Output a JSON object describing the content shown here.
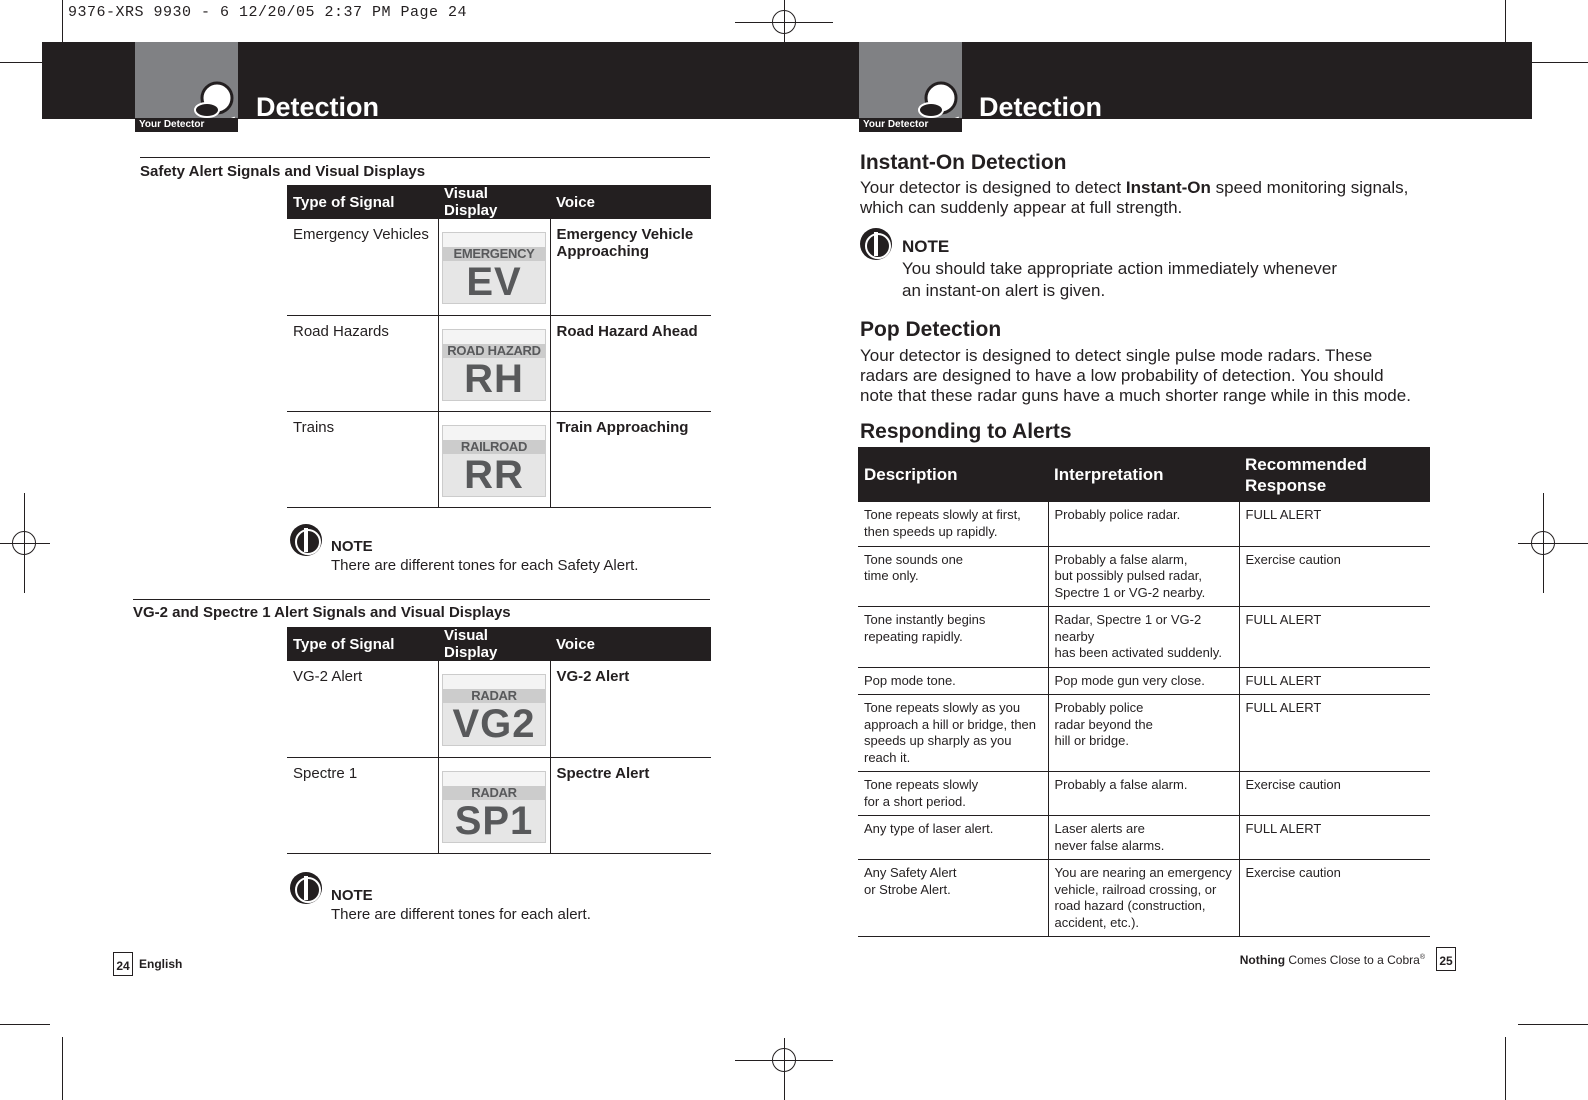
{
  "slug": "9376-XRS 9930 - 6  12/20/05  2:37 PM  Page 24",
  "header": {
    "section_label": "Your Detector",
    "title": "Detection"
  },
  "left": {
    "table1": {
      "heading": "Safety Alert Signals and Visual Displays",
      "columns": [
        "Type of Signal",
        "Visual Display",
        "Voice"
      ],
      "rows": [
        {
          "type": "Emergency Vehicles",
          "display_label": "EMERGENCY",
          "display_code": "EV",
          "voice": "Emergency Vehicle Approaching"
        },
        {
          "type": "Road Hazards",
          "display_label": "ROAD HAZARD",
          "display_code": "RH",
          "voice": "Road Hazard Ahead"
        },
        {
          "type": "Trains",
          "display_label": "RAILROAD",
          "display_code": "RR",
          "voice": "Train Approaching"
        }
      ]
    },
    "note1": {
      "title": "NOTE",
      "text": "There are different tones for each Safety Alert."
    },
    "table2": {
      "heading": "VG-2 and Spectre 1 Alert Signals and Visual Displays",
      "columns": [
        "Type of Signal",
        "Visual Display",
        "Voice"
      ],
      "rows": [
        {
          "type": "VG-2 Alert",
          "display_label": "RADAR",
          "display_code": "VG2",
          "voice": "VG-2 Alert"
        },
        {
          "type": "Spectre 1",
          "display_label": "RADAR",
          "display_code": "SP1",
          "voice": "Spectre Alert"
        }
      ]
    },
    "note2": {
      "title": "NOTE",
      "text": "There are different tones for each alert."
    },
    "footer": {
      "page": "24",
      "label": "English"
    }
  },
  "right": {
    "instant": {
      "title": "Instant-On Detection",
      "text_before": "Your detector is designed to detect ",
      "text_bold": "Instant-On",
      "text_after": " speed monitoring signals, which can suddenly appear at full strength."
    },
    "note": {
      "title": "NOTE",
      "line1": "You should take appropriate action immediately whenever",
      "line2": "an instant-on alert is given."
    },
    "pop": {
      "title": "Pop Detection",
      "text": "Your detector is designed to detect single pulse mode radars. These radars are designed to have a low probability of detection. You should note that these radar guns have a much shorter range while in this mode."
    },
    "responding": {
      "title": "Responding to Alerts",
      "columns": [
        "Description",
        "Interpretation",
        "Recommended Response"
      ],
      "rows": [
        [
          "Tone repeats slowly at first,\nthen speeds up rapidly.",
          "Probably police radar.",
          "FULL ALERT"
        ],
        [
          "Tone sounds one\ntime only.",
          "Probably a false alarm,\nbut possibly pulsed radar,\nSpectre 1 or VG-2 nearby.",
          "Exercise caution"
        ],
        [
          "Tone instantly begins\nrepeating rapidly.",
          "Radar, Spectre 1 or VG-2 nearby\nhas been activated suddenly.",
          "FULL ALERT"
        ],
        [
          "Pop mode tone.",
          "Pop mode gun very close.",
          "FULL ALERT"
        ],
        [
          "Tone repeats slowly as you\napproach a hill or bridge, then\nspeeds up sharply as you\nreach it.",
          "Probably police\nradar beyond the\nhill or bridge.",
          "FULL ALERT"
        ],
        [
          "Tone repeats slowly\nfor a short period.",
          "Probably a false alarm.",
          "Exercise caution"
        ],
        [
          "Any type of laser alert.",
          "Laser alerts are\nnever false alarms.",
          "FULL ALERT"
        ],
        [
          "Any Safety Alert\nor Strobe Alert.",
          "You are nearing an emergency\nvehicle, railroad crossing, or\nroad hazard (construction,\naccident, etc.).",
          "Exercise caution"
        ]
      ]
    },
    "footer": {
      "tagline_bold": "Nothing",
      "tagline": " Comes Close to a Cobra",
      "registered": "®",
      "page": "25"
    }
  }
}
